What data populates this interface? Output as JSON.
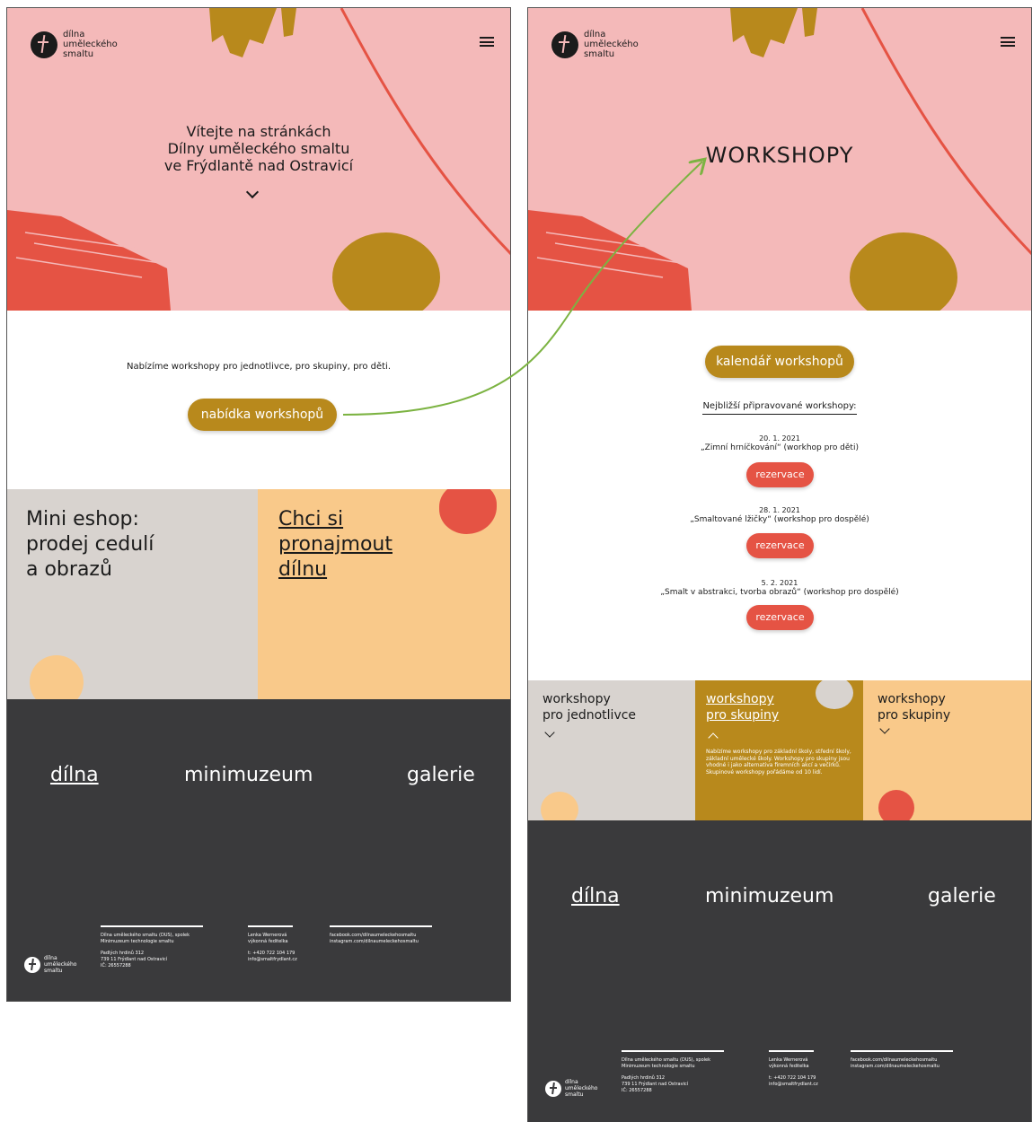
{
  "logo": {
    "line1": "dílna",
    "line2": "uměleckého",
    "line3": "smaltu"
  },
  "home": {
    "hero_line1": "Vítejte na stránkách",
    "hero_line2": "Dílny uměleckého smaltu",
    "hero_line3": "ve Frýdlantě nad Ostravicí",
    "intro_text": "Nabízíme workshopy pro jednotlivce, pro skupiny, pro děti.",
    "offer_button": "nabídka workshopů",
    "tile_eshop": {
      "line1": "Mini eshop:",
      "line2": "prodej cedulí",
      "line3": "a obrazů"
    },
    "tile_rent": {
      "line1": "Chci si",
      "line2": "pronajmout",
      "line3": "dílnu"
    }
  },
  "nav": {
    "dilna": "dílna",
    "minimuzeum": "minimuzeum",
    "galerie": "galerie"
  },
  "workshops": {
    "title": "WORKSHOPY",
    "calendar_button": "kalendář workshopů",
    "upcoming_heading": "Nejbližší připravované workshopy:",
    "items": [
      {
        "date": "20. 1. 2021",
        "name": "„Zimní hrníčkování“ (workhop pro děti)",
        "button": "rezervace"
      },
      {
        "date": "28. 1. 2021",
        "name": "„Smaltované lžičky“ (workshop pro dospělé)",
        "button": "rezervace"
      },
      {
        "date": "5. 2. 2021",
        "name": "„Smalt v abstrakci, tvorba obrazů“ (workshop pro dospělé)",
        "button": "rezervace"
      }
    ],
    "tile_individual": {
      "line1": "workshopy",
      "line2": "pro jednotlivce"
    },
    "tile_groups": {
      "line1": "workshopy",
      "line2": "pro skupiny",
      "desc": "Nabízíme workshopy pro základní školy, střední školy, základní umělecké školy. Workshopy pro skupiny jsou vhodné i jako alternativa firemních akcí a večírků. Skupinové workshopy pořádáme od 10 lidí."
    },
    "tile_groups2": {
      "line1": "workshopy",
      "line2": "pro skupiny"
    }
  },
  "footer": {
    "col1_line1": "Dílna uměleckého smaltu (DUS), spolek",
    "col1_line2": "Minimuzeum technologie smaltu",
    "col1_line3": "Padlých hrdinů 312",
    "col1_line4": "739 11 Frýdlant nad Ostravicí",
    "col1_line5": "IČ: 26557288",
    "col2_line1": "Lenka Wernerová",
    "col2_line2": "výkonná ředitelka",
    "col2_line3": "t: +420 722 104 179",
    "col2_line4": "info@smaltfrydlant.cz",
    "col3_line1": "facebook.com/dilnaumeleckehosmaltu",
    "col3_line2": "instagram.com/dilnaumeleckehosmaltu"
  },
  "colors": {
    "hero_pink": "#f4b9b9",
    "gold": "#b8891c",
    "red": "#e55344",
    "peach": "#f9c98a",
    "grey": "#d8d3cf",
    "dark": "#3a3a3c",
    "arrow_green": "#7cb342"
  }
}
